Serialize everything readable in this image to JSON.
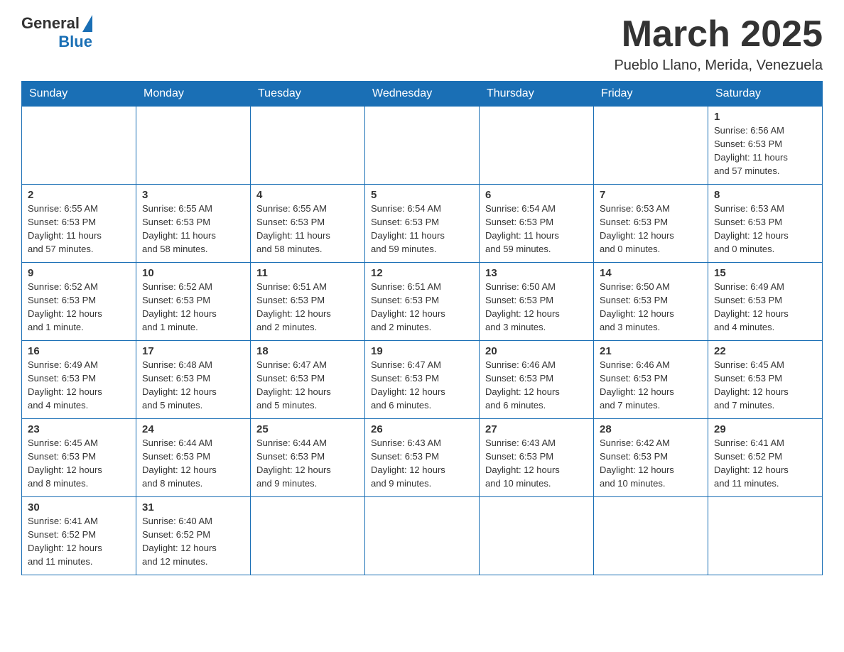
{
  "header": {
    "logo_general": "General",
    "logo_blue": "Blue",
    "month_title": "March 2025",
    "location": "Pueblo Llano, Merida, Venezuela"
  },
  "days_of_week": [
    "Sunday",
    "Monday",
    "Tuesday",
    "Wednesday",
    "Thursday",
    "Friday",
    "Saturday"
  ],
  "weeks": [
    [
      {
        "day": "",
        "info": ""
      },
      {
        "day": "",
        "info": ""
      },
      {
        "day": "",
        "info": ""
      },
      {
        "day": "",
        "info": ""
      },
      {
        "day": "",
        "info": ""
      },
      {
        "day": "",
        "info": ""
      },
      {
        "day": "1",
        "info": "Sunrise: 6:56 AM\nSunset: 6:53 PM\nDaylight: 11 hours\nand 57 minutes."
      }
    ],
    [
      {
        "day": "2",
        "info": "Sunrise: 6:55 AM\nSunset: 6:53 PM\nDaylight: 11 hours\nand 57 minutes."
      },
      {
        "day": "3",
        "info": "Sunrise: 6:55 AM\nSunset: 6:53 PM\nDaylight: 11 hours\nand 58 minutes."
      },
      {
        "day": "4",
        "info": "Sunrise: 6:55 AM\nSunset: 6:53 PM\nDaylight: 11 hours\nand 58 minutes."
      },
      {
        "day": "5",
        "info": "Sunrise: 6:54 AM\nSunset: 6:53 PM\nDaylight: 11 hours\nand 59 minutes."
      },
      {
        "day": "6",
        "info": "Sunrise: 6:54 AM\nSunset: 6:53 PM\nDaylight: 11 hours\nand 59 minutes."
      },
      {
        "day": "7",
        "info": "Sunrise: 6:53 AM\nSunset: 6:53 PM\nDaylight: 12 hours\nand 0 minutes."
      },
      {
        "day": "8",
        "info": "Sunrise: 6:53 AM\nSunset: 6:53 PM\nDaylight: 12 hours\nand 0 minutes."
      }
    ],
    [
      {
        "day": "9",
        "info": "Sunrise: 6:52 AM\nSunset: 6:53 PM\nDaylight: 12 hours\nand 1 minute."
      },
      {
        "day": "10",
        "info": "Sunrise: 6:52 AM\nSunset: 6:53 PM\nDaylight: 12 hours\nand 1 minute."
      },
      {
        "day": "11",
        "info": "Sunrise: 6:51 AM\nSunset: 6:53 PM\nDaylight: 12 hours\nand 2 minutes."
      },
      {
        "day": "12",
        "info": "Sunrise: 6:51 AM\nSunset: 6:53 PM\nDaylight: 12 hours\nand 2 minutes."
      },
      {
        "day": "13",
        "info": "Sunrise: 6:50 AM\nSunset: 6:53 PM\nDaylight: 12 hours\nand 3 minutes."
      },
      {
        "day": "14",
        "info": "Sunrise: 6:50 AM\nSunset: 6:53 PM\nDaylight: 12 hours\nand 3 minutes."
      },
      {
        "day": "15",
        "info": "Sunrise: 6:49 AM\nSunset: 6:53 PM\nDaylight: 12 hours\nand 4 minutes."
      }
    ],
    [
      {
        "day": "16",
        "info": "Sunrise: 6:49 AM\nSunset: 6:53 PM\nDaylight: 12 hours\nand 4 minutes."
      },
      {
        "day": "17",
        "info": "Sunrise: 6:48 AM\nSunset: 6:53 PM\nDaylight: 12 hours\nand 5 minutes."
      },
      {
        "day": "18",
        "info": "Sunrise: 6:47 AM\nSunset: 6:53 PM\nDaylight: 12 hours\nand 5 minutes."
      },
      {
        "day": "19",
        "info": "Sunrise: 6:47 AM\nSunset: 6:53 PM\nDaylight: 12 hours\nand 6 minutes."
      },
      {
        "day": "20",
        "info": "Sunrise: 6:46 AM\nSunset: 6:53 PM\nDaylight: 12 hours\nand 6 minutes."
      },
      {
        "day": "21",
        "info": "Sunrise: 6:46 AM\nSunset: 6:53 PM\nDaylight: 12 hours\nand 7 minutes."
      },
      {
        "day": "22",
        "info": "Sunrise: 6:45 AM\nSunset: 6:53 PM\nDaylight: 12 hours\nand 7 minutes."
      }
    ],
    [
      {
        "day": "23",
        "info": "Sunrise: 6:45 AM\nSunset: 6:53 PM\nDaylight: 12 hours\nand 8 minutes."
      },
      {
        "day": "24",
        "info": "Sunrise: 6:44 AM\nSunset: 6:53 PM\nDaylight: 12 hours\nand 8 minutes."
      },
      {
        "day": "25",
        "info": "Sunrise: 6:44 AM\nSunset: 6:53 PM\nDaylight: 12 hours\nand 9 minutes."
      },
      {
        "day": "26",
        "info": "Sunrise: 6:43 AM\nSunset: 6:53 PM\nDaylight: 12 hours\nand 9 minutes."
      },
      {
        "day": "27",
        "info": "Sunrise: 6:43 AM\nSunset: 6:53 PM\nDaylight: 12 hours\nand 10 minutes."
      },
      {
        "day": "28",
        "info": "Sunrise: 6:42 AM\nSunset: 6:53 PM\nDaylight: 12 hours\nand 10 minutes."
      },
      {
        "day": "29",
        "info": "Sunrise: 6:41 AM\nSunset: 6:52 PM\nDaylight: 12 hours\nand 11 minutes."
      }
    ],
    [
      {
        "day": "30",
        "info": "Sunrise: 6:41 AM\nSunset: 6:52 PM\nDaylight: 12 hours\nand 11 minutes."
      },
      {
        "day": "31",
        "info": "Sunrise: 6:40 AM\nSunset: 6:52 PM\nDaylight: 12 hours\nand 12 minutes."
      },
      {
        "day": "",
        "info": ""
      },
      {
        "day": "",
        "info": ""
      },
      {
        "day": "",
        "info": ""
      },
      {
        "day": "",
        "info": ""
      },
      {
        "day": "",
        "info": ""
      }
    ]
  ]
}
